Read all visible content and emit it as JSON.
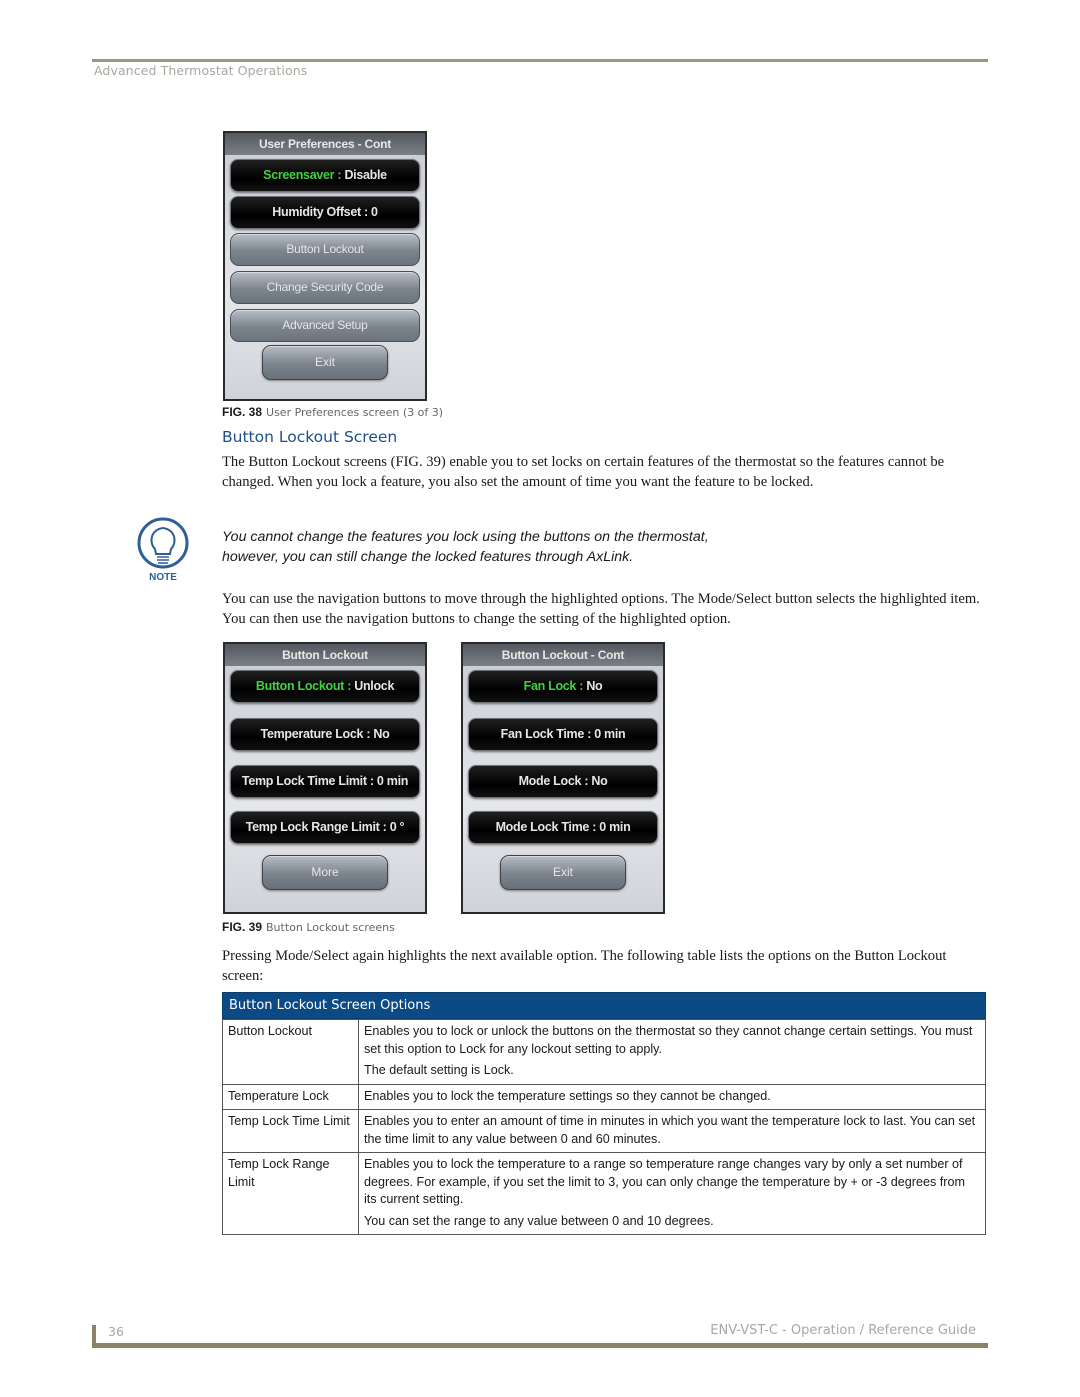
{
  "page": {
    "running_head": "Advanced Thermostat Operations",
    "page_number": "36",
    "guide_title": "ENV-VST-C - Operation / Reference Guide"
  },
  "fig38": {
    "screen": {
      "title": "User Preferences - Cont",
      "items": [
        {
          "label": "Screensaver",
          "sep": " : ",
          "value": "Disable",
          "style": "dark",
          "highlighted": true
        },
        {
          "label": "Humidity Offset : 0",
          "style": "dark",
          "highlighted": false
        },
        {
          "label": "Button Lockout",
          "style": "grey"
        },
        {
          "label": "Change Security Code",
          "style": "grey"
        },
        {
          "label": "Advanced Setup",
          "style": "grey"
        }
      ],
      "exit_label": "Exit"
    },
    "caption_num": "FIG. 38",
    "caption_text": "User Preferences screen (3 of 3)"
  },
  "section": {
    "heading": "Button Lockout Screen",
    "intro": "The Button Lockout screens (FIG. 39) enable you to set locks on certain features of the thermostat so the features cannot be changed. When you lock a feature, you also set the amount of time you want the feature to be locked.",
    "note_label": "NOTE",
    "note_line1": "You cannot change the features you lock using the buttons on the thermostat,",
    "note_line2": "however, you can still change the locked features through AxLink.",
    "nav_text": "You can use the navigation buttons to move through the highlighted options. The Mode/Select button selects the highlighted item. You can then use the navigation buttons to change the setting of the highlighted option."
  },
  "fig39": {
    "screen_a": {
      "title": "Button Lockout",
      "items": [
        {
          "label": "Button Lockout",
          "sep": " : ",
          "value": "Unlock",
          "highlighted": true
        },
        {
          "label": "Temperature Lock : No"
        },
        {
          "label": "Temp Lock Time Limit : 0 min"
        },
        {
          "label": "Temp Lock Range Limit : 0 °"
        }
      ],
      "more_label": "More"
    },
    "screen_b": {
      "title": "Button Lockout - Cont",
      "items": [
        {
          "label": "Fan Lock",
          "sep": " : ",
          "value": "No",
          "highlighted": true
        },
        {
          "label": "Fan Lock Time : 0 min"
        },
        {
          "label": "Mode Lock : No"
        },
        {
          "label": "Mode Lock Time : 0 min"
        }
      ],
      "exit_label": "Exit"
    },
    "caption_num": "FIG. 39",
    "caption_text": "Button Lockout screens"
  },
  "after_fig": "Pressing Mode/Select again highlights the next available option. The following table lists the options on the Button Lockout screen:",
  "options_table": {
    "title": "Button Lockout Screen Options",
    "rows": [
      {
        "option": "Button Lockout",
        "desc": [
          "Enables you to lock or unlock the buttons on the thermostat so they cannot change certain settings. You must set this option to Lock for any lockout setting to apply.",
          "The default setting is Lock."
        ]
      },
      {
        "option": "Temperature Lock",
        "desc": [
          "Enables you to lock the temperature settings so they cannot be changed."
        ]
      },
      {
        "option": "Temp Lock Time Limit",
        "desc": [
          "Enables you to enter an amount of time in minutes in which you want the temperature lock to last. You can set the time limit to any value between 0 and 60 minutes."
        ]
      },
      {
        "option": "Temp Lock Range Limit",
        "desc": [
          "Enables you to lock the temperature to a range so temperature range changes vary by only a set number of degrees. For example, if you set the limit to 3, you can only change the temperature by + or -3 degrees from its current setting.",
          "You can set the range to any value between 0 and 10 degrees."
        ]
      }
    ]
  },
  "colors": {
    "heading_blue": "#1d4f8c",
    "table_header_blue": "#0c4a86",
    "highlight_green": "#3fd43f",
    "rule_olive": "#9a9a7a"
  }
}
